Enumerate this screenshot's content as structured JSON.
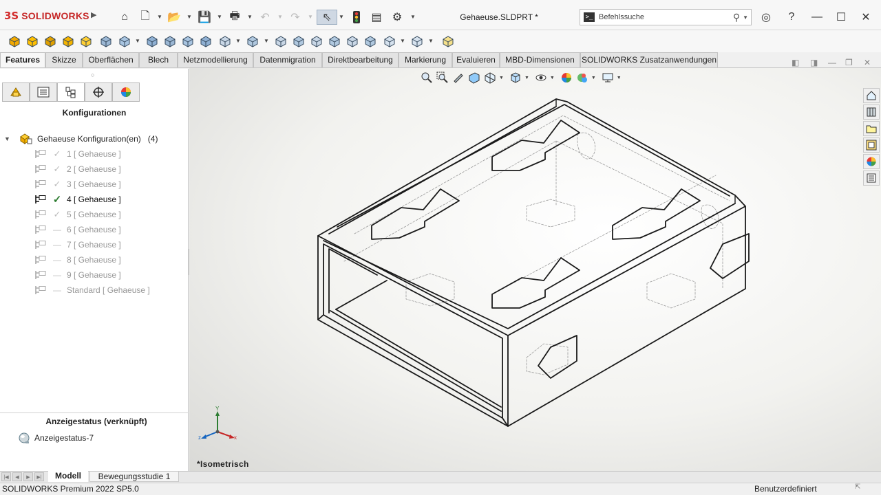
{
  "app": {
    "brand": "SOLIDWORKS",
    "document_title": "Gehaeuse.SLDPRT *"
  },
  "search": {
    "placeholder": "Befehlssuche"
  },
  "tabs": [
    {
      "label": "Features",
      "active": true
    },
    {
      "label": "Skizze"
    },
    {
      "label": "Oberflächen"
    },
    {
      "label": "Blech"
    },
    {
      "label": "Netzmodellierung"
    },
    {
      "label": "Datenmigration"
    },
    {
      "label": "Direktbearbeitung"
    },
    {
      "label": "Markierung"
    },
    {
      "label": "Evaluieren"
    },
    {
      "label": "MBD-Dimensionen"
    },
    {
      "label": "SOLIDWORKS Zusatzanwendungen"
    }
  ],
  "panel": {
    "title": "Konfigurationen",
    "root": {
      "label": "Gehaeuse Konfiguration(en)",
      "count": "(4)"
    },
    "configs": [
      {
        "label": "1 [ Gehaeuse ]",
        "mark": "check"
      },
      {
        "label": "2 [ Gehaeuse ]",
        "mark": "check"
      },
      {
        "label": "3 [ Gehaeuse ]",
        "mark": "check"
      },
      {
        "label": "4 [ Gehaeuse ]",
        "mark": "check",
        "active": true
      },
      {
        "label": "5 [ Gehaeuse ]",
        "mark": "check"
      },
      {
        "label": "6 [ Gehaeuse ]",
        "mark": "dash"
      },
      {
        "label": "7 [ Gehaeuse ]",
        "mark": "dash"
      },
      {
        "label": "8 [ Gehaeuse ]",
        "mark": "dash"
      },
      {
        "label": "9 [ Gehaeuse ]",
        "mark": "dash"
      },
      {
        "label": "Standard [ Gehaeuse ]",
        "mark": "dash"
      }
    ],
    "display_state_title": "Anzeigestatus (verknüpft)",
    "display_state_item": "Anzeigestatus-7"
  },
  "viewport": {
    "view_name": "*Isometrisch",
    "triad": {
      "x": "x",
      "y": "Y",
      "z": "z"
    }
  },
  "bottom_tabs": {
    "model": "Modell",
    "motion": "Bewegungsstudie 1"
  },
  "status": {
    "left": "SOLIDWORKS Premium 2022 SP5.0",
    "right": "Benutzerdefiniert"
  },
  "colors": {
    "accent_red": "#d32f2f",
    "check_active": "#2e7d32",
    "check_inactive": "#bdbdbd",
    "tab_active_bg": "#f7f7f7"
  }
}
